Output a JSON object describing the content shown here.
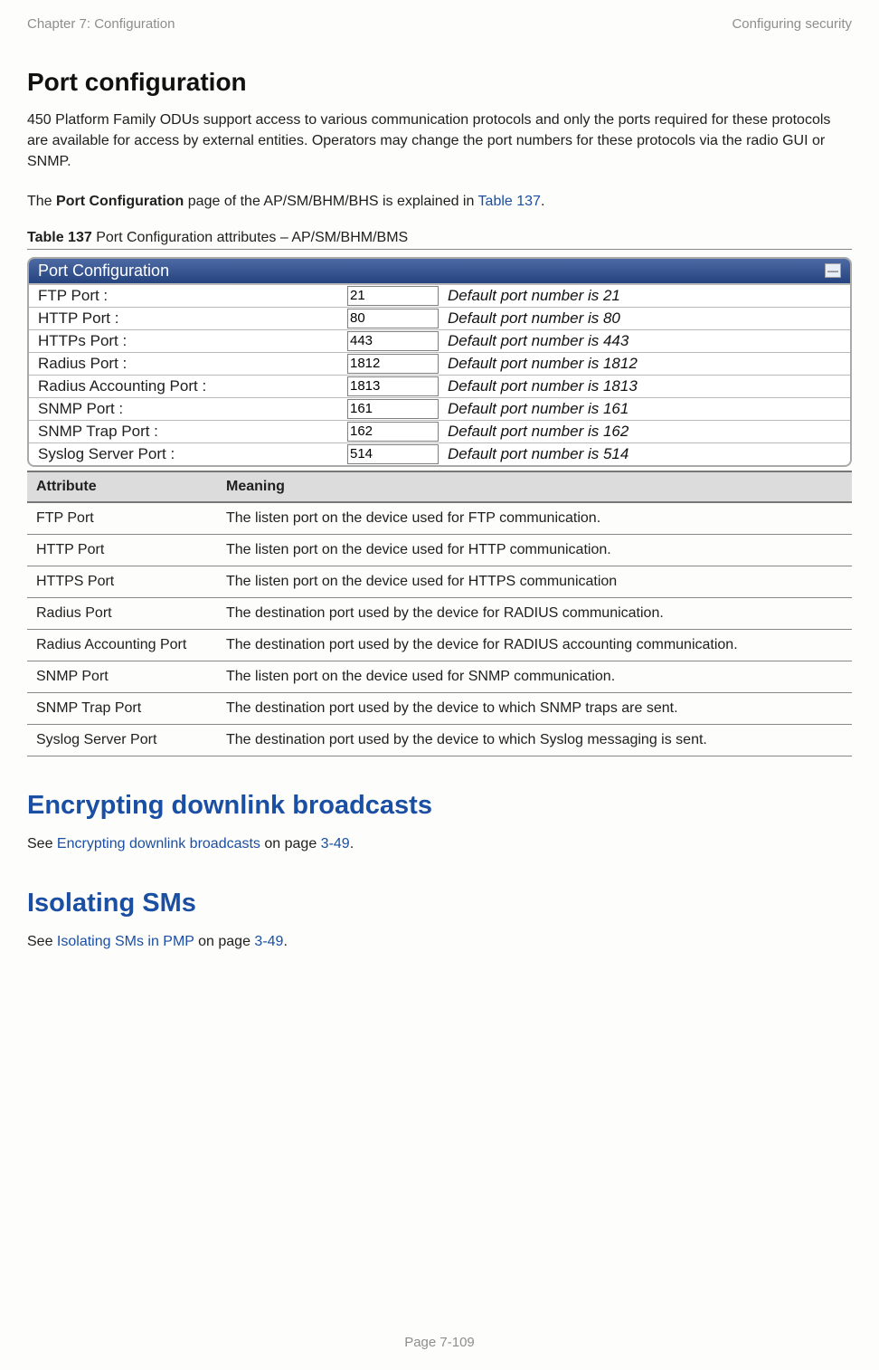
{
  "header": {
    "left": "Chapter 7:  Configuration",
    "right": "Configuring security"
  },
  "h1": "Port configuration",
  "intro": "450 Platform Family ODUs support access to various communication protocols and only the ports required for these protocols are available for access by external entities. Operators may change the port numbers for these protocols via the radio GUI or SNMP.",
  "explain_pre": "The ",
  "explain_bold": "Port Configuration",
  "explain_mid": " page of the AP/SM/BHM/BHS is explained in ",
  "explain_link": "Table 137",
  "explain_post": ".",
  "caption_bold": "Table 137",
  "caption_rest": " Port Configuration attributes – AP/SM/BHM/BMS",
  "panel": {
    "title": "Port Configuration",
    "rows": [
      {
        "label": "FTP Port :",
        "value": "21",
        "note": "Default port number is 21"
      },
      {
        "label": "HTTP Port :",
        "value": "80",
        "note": "Default port number is 80"
      },
      {
        "label": "HTTPs Port :",
        "value": "443",
        "note": "Default port number is 443"
      },
      {
        "label": "Radius Port :",
        "value": "1812",
        "note": "Default port number is 1812"
      },
      {
        "label": "Radius Accounting Port :",
        "value": "1813",
        "note": "Default port number is 1813"
      },
      {
        "label": "SNMP Port :",
        "value": "161",
        "note": "Default port number is 161"
      },
      {
        "label": "SNMP Trap Port :",
        "value": "162",
        "note": "Default port number is 162"
      },
      {
        "label": "Syslog Server Port :",
        "value": "514",
        "note": "Default port number is 514"
      }
    ]
  },
  "attr_table": {
    "h_attr": "Attribute",
    "h_meaning": "Meaning",
    "rows": [
      {
        "attr": "FTP Port",
        "meaning": "The listen port on the device used for FTP communication."
      },
      {
        "attr": "HTTP Port",
        "meaning": "The listen port on the device used for HTTP communication."
      },
      {
        "attr": "HTTPS Port",
        "meaning": "The listen port on the device used for HTTPS communication"
      },
      {
        "attr": "Radius Port",
        "meaning": "The destination port used by the device for RADIUS communication."
      },
      {
        "attr": "Radius Accounting Port",
        "meaning": "The destination port used by the device for RADIUS accounting communication."
      },
      {
        "attr": "SNMP Port",
        "meaning": "The listen port on the device used for SNMP communication."
      },
      {
        "attr": "SNMP Trap Port",
        "meaning": "The destination port used by the device to which SNMP traps are sent."
      },
      {
        "attr": "Syslog Server Port",
        "meaning": "The destination port used by the device to which Syslog messaging is sent."
      }
    ]
  },
  "sec1": {
    "title": "Encrypting downlink broadcasts",
    "pre": "See ",
    "link": "Encrypting downlink broadcasts",
    "mid": " on page ",
    "page": "3-49",
    "post": "."
  },
  "sec2": {
    "title": "Isolating SMs",
    "pre": "See ",
    "link": "Isolating SMs in PMP",
    "mid": " on page ",
    "page": "3-49",
    "post": "."
  },
  "footer": "Page 7-109",
  "collapse_glyph": "—"
}
